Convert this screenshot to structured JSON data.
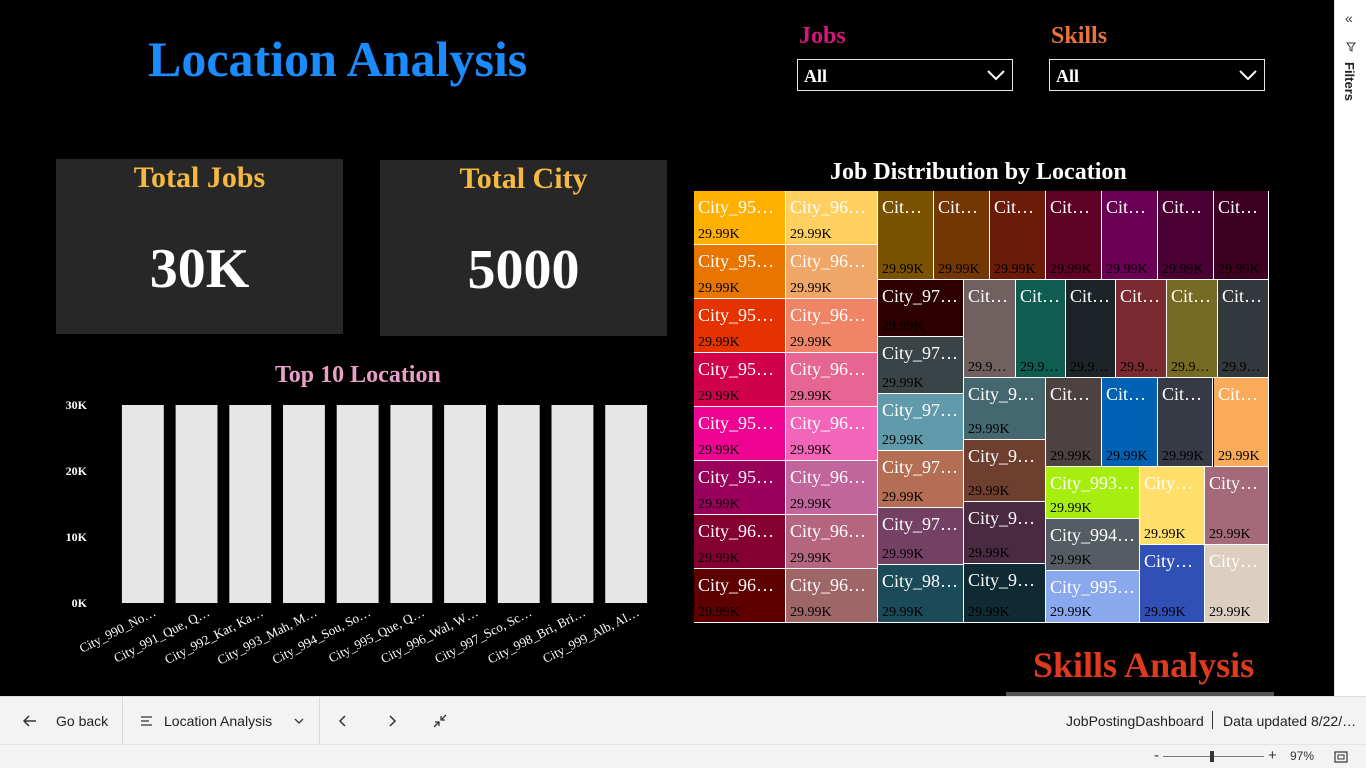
{
  "page": {
    "title": "Location Analysis",
    "skills_title": "Skills Analysis"
  },
  "slicers": {
    "jobs": {
      "label": "Jobs",
      "value": "All",
      "color": "#d6187a"
    },
    "skills": {
      "label": "Skills",
      "value": "All",
      "color": "#e8743b"
    }
  },
  "cards": {
    "total_jobs": {
      "title": "Total Jobs",
      "value": "30K"
    },
    "total_city": {
      "title": "Total City",
      "value": "5000"
    }
  },
  "charts": {
    "top10_title": "Top 10 Location",
    "top10_title_color": "#e8a0c8",
    "treemap_title": "Job Distribution by Location"
  },
  "chart_data": [
    {
      "type": "bar",
      "title": "Top 10 Location",
      "categories": [
        "City_990_No…",
        "City_991_Que, Q…",
        "City_992_Kar, Ka…",
        "City_993_Mah, M…",
        "City_994_Sou, So…",
        "City_995_Que, Q…",
        "City_996_Wal, W…",
        "City_997_Sco, Sc…",
        "City_998_Bri, Bri…",
        "City_999_Alb, Al…"
      ],
      "values": [
        30000,
        30000,
        30000,
        30000,
        30000,
        30000,
        30000,
        30000,
        30000,
        30000
      ],
      "yticks": [
        "0K",
        "10K",
        "20K",
        "30K"
      ],
      "ylim": [
        0,
        30000
      ],
      "bar_color": "#e6e6e6"
    },
    {
      "type": "treemap",
      "title": "Job Distribution by Location",
      "value_label": "29.99K",
      "tiles": [
        {
          "name": "City_95…",
          "value": "29.99K",
          "color": "#ffb000",
          "val_color": "#000"
        },
        {
          "name": "City_95…",
          "value": "29.99K",
          "color": "#e87500",
          "val_color": "#000"
        },
        {
          "name": "City_95…",
          "value": "29.99K",
          "color": "#e43200",
          "val_color": "#000"
        },
        {
          "name": "City_95…",
          "value": "29.99K",
          "color": "#d0004a",
          "val_color": "#000"
        },
        {
          "name": "City_95…",
          "value": "29.99K",
          "color": "#ef0393",
          "val_color": "#000"
        },
        {
          "name": "City_95…",
          "value": "29.99K",
          "color": "#9a005b",
          "val_color": "#000"
        },
        {
          "name": "City_96…",
          "value": "29.99K",
          "color": "#830030",
          "val_color": "#000"
        },
        {
          "name": "City_96…",
          "value": "29.99K",
          "color": "#5e0000",
          "val_color": "#000"
        },
        {
          "name": "City_96…",
          "value": "29.99K",
          "color": "#ffcf60",
          "val_color": "#000"
        },
        {
          "name": "City_96…",
          "value": "29.99K",
          "color": "#efa666",
          "val_color": "#000"
        },
        {
          "name": "City_96…",
          "value": "29.99K",
          "color": "#ef8466",
          "val_color": "#000"
        },
        {
          "name": "City_96…",
          "value": "29.99K",
          "color": "#e66592",
          "val_color": "#000"
        },
        {
          "name": "City_96…",
          "value": "29.99K",
          "color": "#f365b8",
          "val_color": "#000"
        },
        {
          "name": "City_96…",
          "value": "29.99K",
          "color": "#c2659d",
          "val_color": "#000"
        },
        {
          "name": "City_96…",
          "value": "29.99K",
          "color": "#b5667f",
          "val_color": "#000"
        },
        {
          "name": "City_96…",
          "value": "29.99K",
          "color": "#9e6666",
          "val_color": "#000"
        },
        {
          "name": "Cit…",
          "value": "29.99K",
          "color": "#7b5201",
          "val_color": "#000"
        },
        {
          "name": "Cit…",
          "value": "29.99K",
          "color": "#733605",
          "val_color": "#000"
        },
        {
          "name": "Cit…",
          "value": "29.99K",
          "color": "#6b1b08",
          "val_color": "#000"
        },
        {
          "name": "Cit…",
          "value": "29.99K",
          "color": "#5f0025",
          "val_color": "#000"
        },
        {
          "name": "Cit…",
          "value": "29.99K",
          "color": "#6a0054",
          "val_color": "#000"
        },
        {
          "name": "Cit…",
          "value": "29.99K",
          "color": "#4a0035",
          "val_color": "#000"
        },
        {
          "name": "Cit…",
          "value": "29.99K",
          "color": "#3d0020",
          "val_color": "#000"
        },
        {
          "name": "City_97…",
          "value": "29.99K",
          "color": "#2d0002",
          "val_color": "#000"
        },
        {
          "name": "Cit…",
          "value": "29.9…",
          "color": "#706060",
          "val_color": "#000"
        },
        {
          "name": "Cit…",
          "value": "29.9…",
          "color": "#0f5c50",
          "val_color": "#000"
        },
        {
          "name": "Cit…",
          "value": "29.9…",
          "color": "#1c2428",
          "val_color": "#000"
        },
        {
          "name": "Cit…",
          "value": "29.9…",
          "color": "#7a2a30",
          "val_color": "#000"
        },
        {
          "name": "Cit…",
          "value": "29.9…",
          "color": "#776a22",
          "val_color": "#000"
        },
        {
          "name": "Cit…",
          "value": "29.9…",
          "color": "#32383c",
          "val_color": "#000"
        },
        {
          "name": "City_97…",
          "value": "29.99K",
          "color": "#3a4446",
          "val_color": "#000"
        },
        {
          "name": "City_97…",
          "value": "29.99K",
          "color": "#619aaa",
          "val_color": "#000"
        },
        {
          "name": "City_97…",
          "value": "29.99K",
          "color": "#b36e54",
          "val_color": "#000"
        },
        {
          "name": "City_97…",
          "value": "29.99K",
          "color": "#744164",
          "val_color": "#000"
        },
        {
          "name": "City_98…",
          "value": "29.99K",
          "color": "#1b4a58",
          "val_color": "#000"
        },
        {
          "name": "City_9…",
          "value": "29.99K",
          "color": "#456870",
          "val_color": "#000"
        },
        {
          "name": "City_9…",
          "value": "29.99K",
          "color": "#6e3e2e",
          "val_color": "#000"
        },
        {
          "name": "City_9…",
          "value": "29.99K",
          "color": "#4a2a40",
          "val_color": "#000"
        },
        {
          "name": "City_9…",
          "value": "29.99K",
          "color": "#0f2a32",
          "val_color": "#000"
        },
        {
          "name": "Cit…",
          "value": "29.99K",
          "color": "#4d4242",
          "val_color": "#000"
        },
        {
          "name": "Cit…",
          "value": "29.99K",
          "color": "#0062b4",
          "val_color": "#000"
        },
        {
          "name": "Cit…",
          "value": "29.99K",
          "color": "#353a44",
          "val_color": "#000"
        },
        {
          "name": "Cit…",
          "value": "29.99K",
          "color": "#f9ab5a",
          "val_color": "#000"
        },
        {
          "name": "City_993…",
          "value": "29.99K",
          "color": "#a7ee10",
          "val_color": "#000"
        },
        {
          "name": "City…",
          "value": "29.99K",
          "color": "#ffdf6a",
          "val_color": "#000"
        },
        {
          "name": "City…",
          "value": "29.99K",
          "color": "#a56a7a",
          "val_color": "#000"
        },
        {
          "name": "City_994…",
          "value": "29.99K",
          "color": "#565c64",
          "val_color": "#000"
        },
        {
          "name": "City_995…",
          "value": "29.99K",
          "color": "#8aa8ee",
          "val_color": "#000"
        },
        {
          "name": "City…",
          "value": "29.99K",
          "color": "#3150b6",
          "val_color": "#000"
        },
        {
          "name": "City…",
          "value": "29.99K",
          "color": "#dccfc0",
          "val_color": "#000"
        }
      ]
    }
  ],
  "filters_pane": {
    "label": "Filters",
    "collapse_icon": "double-chevron-left-icon"
  },
  "bottom_bar": {
    "go_back": "Go back",
    "page_selector": "Location Analysis",
    "report_name": "JobPostingDashboard",
    "data_updated": "Data updated 8/22/…"
  },
  "status_bar": {
    "zoom_minus": "-",
    "zoom_plus": "+",
    "zoom_level": "97%"
  }
}
